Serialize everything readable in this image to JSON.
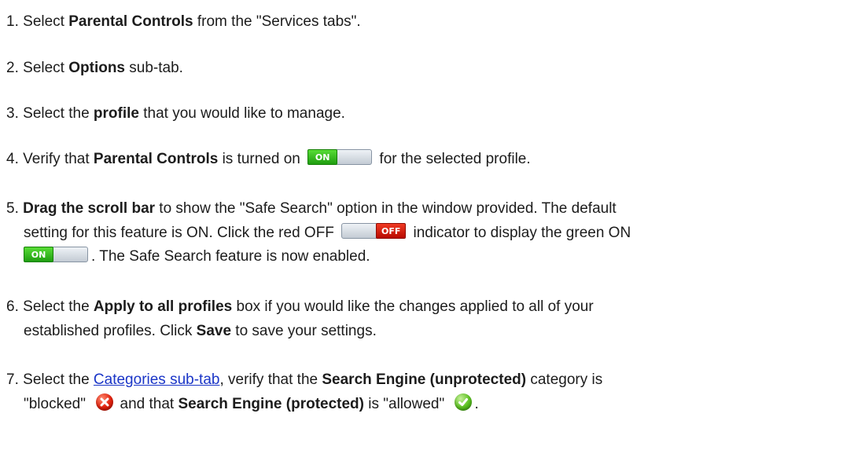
{
  "steps": [
    {
      "num": "1.",
      "t1": "Select ",
      "b1": "Parental Controls",
      "t2": " from the \"Services tabs\"."
    },
    {
      "num": "2.",
      "t1": "Select ",
      "b1": "Options",
      "t2": " sub-tab."
    },
    {
      "num": "3.",
      "t1": "Select the ",
      "b1": "profile",
      "t2": " that you would like to manage."
    },
    {
      "num": "4.",
      "t1": "Verify that ",
      "b1": "Parental Controls",
      "t2": " is turned on ",
      "t3": " for the selected profile."
    },
    {
      "num": "5.",
      "b1": "Drag the scroll bar",
      "t1": " to show the \"Safe Search\" option in the window provided. The default",
      "t2": "setting for this feature is ON. Click the red OFF ",
      "t3": " indicator to display the green ON",
      "t4": ". The Safe Search feature is now enabled."
    },
    {
      "num": "6.",
      "t1": "Select the ",
      "b1": "Apply to all profiles",
      "t2": " box if you would like the changes applied to all of your",
      "t3": "established profiles. Click ",
      "b2": "Save",
      "t4": " to save your settings."
    },
    {
      "num": "7.",
      "t1": "Select the ",
      "link": "Categories sub-tab",
      "t2": ", verify that the ",
      "b1": "Search Engine (unprotected)",
      "t3": " category is",
      "t4": "\"blocked\" ",
      "t5": " and that ",
      "b2": "Search Engine (protected)",
      "t6": " is \"allowed\" ",
      "t7": "."
    }
  ],
  "toggles": {
    "on_label": "ON",
    "off_label": "OFF"
  },
  "icons": {
    "toggle_on": "toggle-on-icon",
    "toggle_off": "toggle-off-icon",
    "blocked": "blocked-x-icon",
    "allowed": "allowed-check-icon"
  },
  "colors": {
    "link": "#1a35c7",
    "toggle_on": "#2fb51a",
    "toggle_off": "#d01a0a",
    "blocked": "#e0200c",
    "allowed": "#5abf1f"
  }
}
